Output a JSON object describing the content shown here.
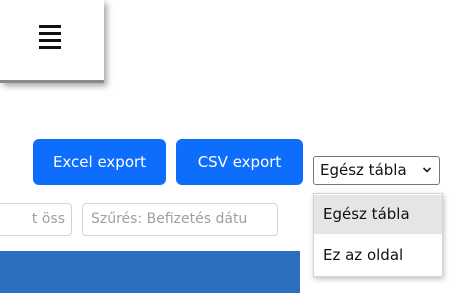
{
  "menu": {
    "icon": "hamburger-menu-icon"
  },
  "toolbar": {
    "excel_label": "Excel export",
    "csv_label": "CSV export",
    "scope_select": {
      "value": "Egész tábla",
      "icon": "chevron-down-icon"
    }
  },
  "filters": {
    "col1_placeholder_visible": "t öss",
    "col2_placeholder": "Szűrés: Befizetés dátu"
  },
  "dropdown": {
    "options": [
      "Egész tábla",
      "Ez az oldal"
    ],
    "highlighted_index": 0
  },
  "colors": {
    "button": "#0d6efd",
    "table_header": "#2c6fc1"
  }
}
